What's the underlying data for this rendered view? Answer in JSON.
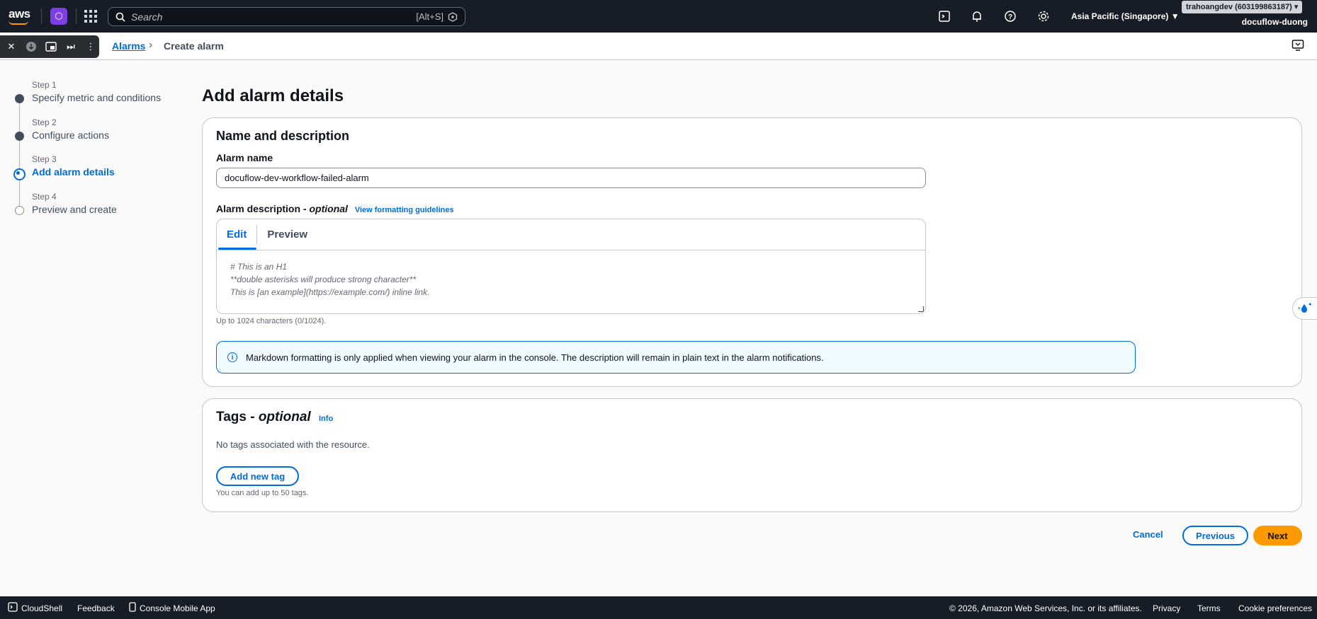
{
  "topnav": {
    "logo_text": "aws",
    "service_badge_glyph": "⬡",
    "search_placeholder": "Search",
    "search_shortcut": "[Alt+S]",
    "region": "Asia Pacific (Singapore) ▼",
    "account": "trahoangdev (603199863187) ▾",
    "user": "docuflow-duong"
  },
  "breadcrumb": {
    "parent": "Alarms",
    "separator": "›",
    "current": "Create alarm"
  },
  "steps": [
    {
      "num": "Step 1",
      "label": "Specify metric and conditions",
      "state": "done"
    },
    {
      "num": "Step 2",
      "label": "Configure actions",
      "state": "done"
    },
    {
      "num": "Step 3",
      "label": "Add alarm details",
      "state": "active"
    },
    {
      "num": "Step 4",
      "label": "Preview and create",
      "state": "todo"
    }
  ],
  "page_title": "Add alarm details",
  "name_panel": {
    "heading": "Name and description",
    "alarm_name_label": "Alarm name",
    "alarm_name_value": "docuflow-dev-workflow-failed-alarm",
    "desc_label": "Alarm description -",
    "desc_optional": "optional",
    "formatting_link": "View formatting guidelines",
    "tab_edit": "Edit",
    "tab_preview": "Preview",
    "desc_placeholder": "# This is an H1\n**double asterisks will produce strong character**\nThis is [an example](https://example.com/) inline link.",
    "char_hint": "Up to 1024 characters (0/1024).",
    "info_icon": "i",
    "info_text": "Markdown formatting is only applied when viewing your alarm in the console. The description will remain in plain text in the alarm notifications."
  },
  "tags_panel": {
    "heading": "Tags -",
    "optional": "optional",
    "info_link": "Info",
    "empty_text": "No tags associated with the resource.",
    "add_button": "Add new tag",
    "limit_hint": "You can add up to 50 tags."
  },
  "actions": {
    "cancel": "Cancel",
    "previous": "Previous",
    "next": "Next"
  },
  "footer": {
    "cloudshell": "CloudShell",
    "feedback": "Feedback",
    "mobile_app": "Console Mobile App",
    "copyright": "© 2026, Amazon Web Services, Inc. or its affiliates.",
    "privacy": "Privacy",
    "terms": "Terms",
    "cookies": "Cookie preferences"
  },
  "colors": {
    "nav_bg": "#161d26",
    "link_blue": "#006ce0",
    "primary_orange": "#ff9900",
    "service_purple": "#7b3fe4"
  }
}
